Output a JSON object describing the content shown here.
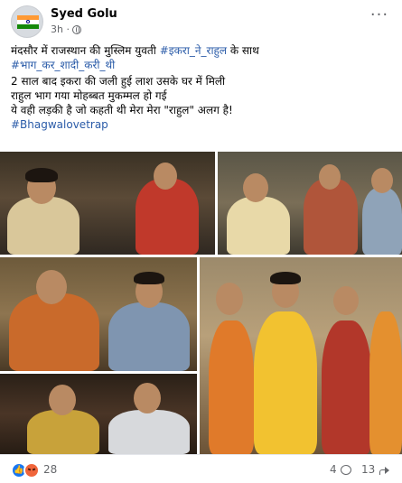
{
  "post": {
    "author": "Syed Golu",
    "time": "3h ·",
    "more_label": "···",
    "text_lines": [
      "मंदसौर में राजस्थान की मुस्लिम युवती ",
      "2 साल बाद इकरा की जली हुई लाश उसके घर में मिली",
      "राहुल भाग गया मोहब्बत मुकम्मल हो गई",
      "ये वही लड़की है जो कहती थी मेरा मेरा \"राहुल\" अलग है!"
    ],
    "hashtag_1": "#इकरा_ने_राहुल",
    "after_hashtag_1": " के साथ",
    "hashtag_2": "#भाग_कर_शादी_करी_थी",
    "hashtag_3": "#Bhagwalovetrap"
  },
  "reactions": {
    "count": "28",
    "comments": "4",
    "shares": "13"
  },
  "colors": {
    "link": "#2a5ba8",
    "muted": "#65676b",
    "like_blue": "#1877f2",
    "angry_orange": "#f0653b"
  },
  "icons": [
    "globe-icon",
    "more-icon",
    "like-icon",
    "angry-icon",
    "comment-icon",
    "share-icon"
  ]
}
